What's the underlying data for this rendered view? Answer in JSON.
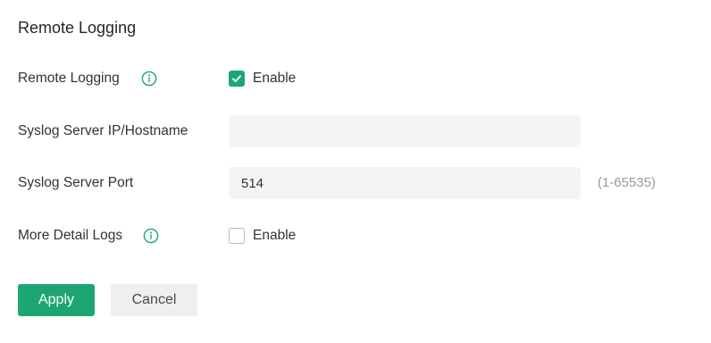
{
  "section": {
    "title": "Remote Logging"
  },
  "fields": {
    "remote_logging": {
      "label": "Remote Logging",
      "checkbox_label": "Enable",
      "checked": true
    },
    "syslog_server": {
      "label": "Syslog Server IP/Hostname",
      "value": "",
      "placeholder": ""
    },
    "syslog_port": {
      "label": "Syslog Server Port",
      "value": "514",
      "hint": "(1-65535)"
    },
    "more_detail_logs": {
      "label": "More Detail Logs",
      "checkbox_label": "Enable",
      "checked": false
    }
  },
  "actions": {
    "apply_label": "Apply",
    "cancel_label": "Cancel"
  },
  "icons": {
    "info": "info-circle-icon",
    "check": "checkmark-icon"
  },
  "colors": {
    "accent": "#1ea672",
    "input_bg": "#f4f4f4",
    "hint_text": "#999999"
  }
}
